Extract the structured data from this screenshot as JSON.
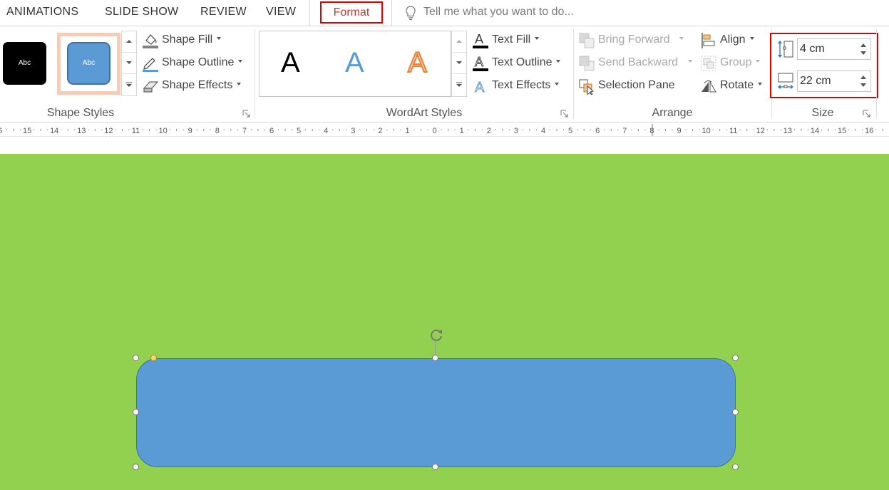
{
  "tabs": {
    "animations": "ANIMATIONS",
    "slide_show": "SLIDE SHOW",
    "review": "REVIEW",
    "view": "VIEW",
    "format": "Format"
  },
  "tell_me": {
    "placeholder": "Tell me what you want to do..."
  },
  "shape_styles": {
    "group_label": "Shape Styles",
    "thumb_text": "Abc",
    "fill": "Shape Fill",
    "outline": "Shape Outline",
    "effects": "Shape Effects"
  },
  "wordart_styles": {
    "group_label": "WordArt Styles",
    "sample": "A",
    "text_fill": "Text Fill",
    "text_outline": "Text Outline",
    "text_effects": "Text Effects"
  },
  "arrange": {
    "group_label": "Arrange",
    "bring_forward": "Bring Forward",
    "send_backward": "Send Backward",
    "selection_pane": "Selection Pane",
    "align": "Align",
    "group": "Group",
    "rotate": "Rotate"
  },
  "size": {
    "group_label": "Size",
    "height": "4 cm",
    "width": "22 cm"
  },
  "ruler": {
    "labels": [
      "6",
      "15",
      "14",
      "13",
      "12",
      "11",
      "10",
      "9",
      "8",
      "7",
      "6",
      "5",
      "4",
      "3",
      "2",
      "1",
      "0",
      "1",
      "2",
      "3",
      "4",
      "5",
      "6",
      "7",
      "8",
      "9",
      "10",
      "11",
      "12",
      "13",
      "14",
      "15",
      "16"
    ]
  },
  "colors": {
    "slide_background": "#92d050",
    "shape_fill": "#5b9bd5",
    "highlight_red": "#e00000"
  }
}
